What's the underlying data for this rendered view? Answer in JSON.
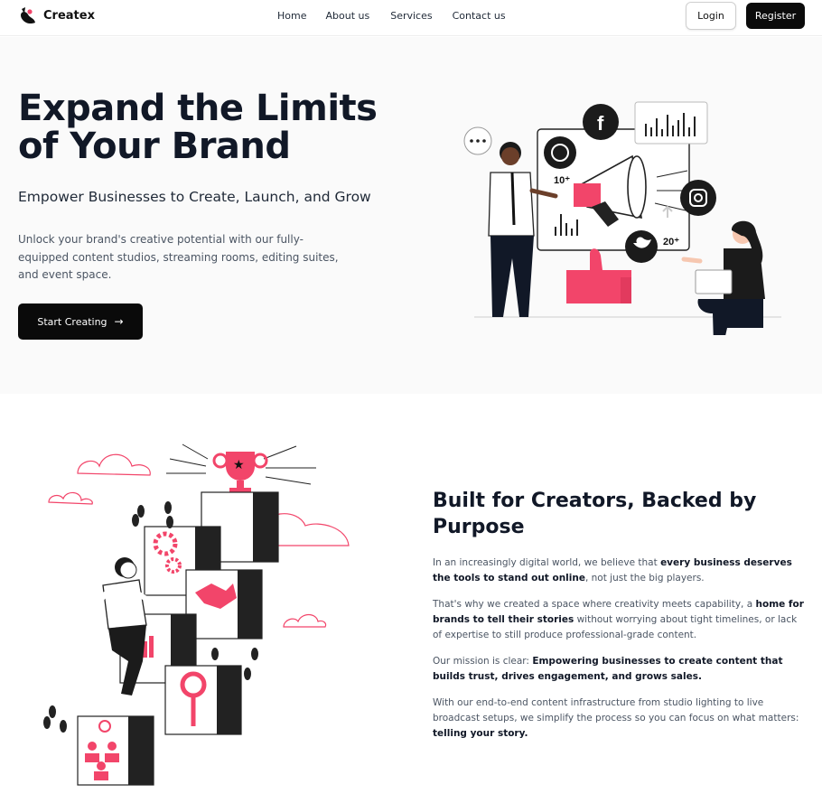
{
  "nav": {
    "brand": "Createx",
    "links": [
      "Home",
      "About us",
      "Services",
      "Contact us"
    ],
    "login": "Login",
    "register": "Register"
  },
  "hero": {
    "title": "Expand the Limits of Your Brand",
    "subtitle": "Empower Businesses to Create, Launch, and Grow",
    "description": "Unlock your brand's creative potential with our fully-equipped content studios, streaming rooms, editing suites, and event space.",
    "cta": "Start Creating",
    "illustration": {
      "stat_left": "10⁺",
      "stat_right": "20⁺"
    }
  },
  "about": {
    "title": "Built for Creators, Backed by Purpose",
    "p1": {
      "a": "In an increasingly digital world, we believe that ",
      "b": "every business deserves the tools to stand out online",
      "c": ", not just the big players."
    },
    "p2": {
      "a": "That's why we created a space where creativity meets capability, a ",
      "b": "home for brands to tell their stories",
      "c": " without worrying about tight timelines, or lack of expertise to still produce professional-grade content."
    },
    "p3": {
      "a": "Our mission is clear: ",
      "b": "Empowering businesses to create content that builds trust, drives engagement, and grows sales."
    },
    "p4": {
      "a": "With our end-to-end content infrastructure from studio lighting to live broadcast setups, we simplify the process so you can focus on what matters: ",
      "b": "telling your story."
    }
  },
  "colors": {
    "accent": "#f2456a",
    "dark": "#0b0b0b",
    "text": "#111827"
  }
}
